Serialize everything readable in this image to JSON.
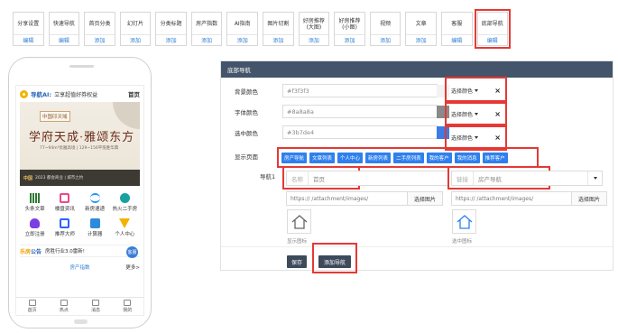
{
  "modules": [
    {
      "name": "分享设置",
      "action": "编辑"
    },
    {
      "name": "快速导航",
      "action": "编辑"
    },
    {
      "name": "首页分类",
      "action": "添加"
    },
    {
      "name": "幻灯片",
      "action": "添加"
    },
    {
      "name": "分类标题",
      "action": "添加"
    },
    {
      "name": "房产指数",
      "action": "添加"
    },
    {
      "name": "AI指南",
      "action": "添加"
    },
    {
      "name": "图片切割",
      "action": "添加"
    },
    {
      "name": "好房推荐\n(大图)",
      "action": "添加"
    },
    {
      "name": "好房推荐\n(小图)",
      "action": "添加"
    },
    {
      "name": "视频",
      "action": "添加"
    },
    {
      "name": "文章",
      "action": "添加"
    },
    {
      "name": "客服",
      "action": "编辑"
    },
    {
      "name": "底部导航",
      "action": "编辑"
    }
  ],
  "phone": {
    "brand": "导航AI:",
    "slogan": "立享超值好券权益",
    "menu": "首页",
    "banner": {
      "tag": "中国印天域",
      "hero_a": "学府天成",
      "hero_b": "雅颂东方",
      "sub": "77~94m²优雅高境 | 129~156平揽胜华典",
      "foot_logo": "中国",
      "foot_text": "2023 都会商业 | 城市之约"
    },
    "grid": [
      {
        "label": "头条文章",
        "icon": "bars-icon"
      },
      {
        "label": "楼盘资讯",
        "icon": "window-icon"
      },
      {
        "label": "新房速递",
        "icon": "wave-icon"
      },
      {
        "label": "热火二手房",
        "icon": "star-icon"
      },
      {
        "label": "立即注册",
        "icon": "bulb-icon"
      },
      {
        "label": "推荐大师",
        "icon": "record-icon"
      },
      {
        "label": "计算器",
        "icon": "calculator-icon"
      },
      {
        "label": "个人中心",
        "icon": "triangle-icon"
      }
    ],
    "notice_a": "乐房",
    "notice_b": "公告",
    "notice_text": "房胜行业3.0雷新!",
    "fab": "客服",
    "section": "房产指数",
    "more": "更多>",
    "tabs": [
      {
        "label": "首页"
      },
      {
        "label": "热点"
      },
      {
        "label": "消息"
      },
      {
        "label": "我的"
      }
    ]
  },
  "panel": {
    "title": "底部导航",
    "bg_label": "背景颜色",
    "bg_value": "#f3f3f3",
    "font_label": "字体颜色",
    "font_value": "#8a8a8a",
    "sel_label": "选中颜色",
    "sel_value": "#3b7de4",
    "choose_color": "选择颜色",
    "pages_label": "显示页面",
    "pages": [
      "房产导航",
      "文章列表",
      "个人中心",
      "新房列表",
      "二手房列表",
      "我的客户",
      "我的消息",
      "推荐客户"
    ],
    "nav_label": "导航1",
    "name_prefix": "名称",
    "name_value": "首页",
    "link_prefix": "链接",
    "link_value": "房产导航",
    "url_left": "https://                         /attachment/images/",
    "url_right": "https://                        /attachment/images/",
    "choose_image": "选择图片",
    "show_icon": "显示图标",
    "selected_icon": "选中图标",
    "save": "保存",
    "add_nav": "添加导航"
  },
  "colors": {
    "bg": "#f3f3f3",
    "font": "#8a8a8a",
    "selected": "#3b7de4",
    "header": "#44546a",
    "page_button": "#2f80ed",
    "highlight": "#e53935"
  }
}
